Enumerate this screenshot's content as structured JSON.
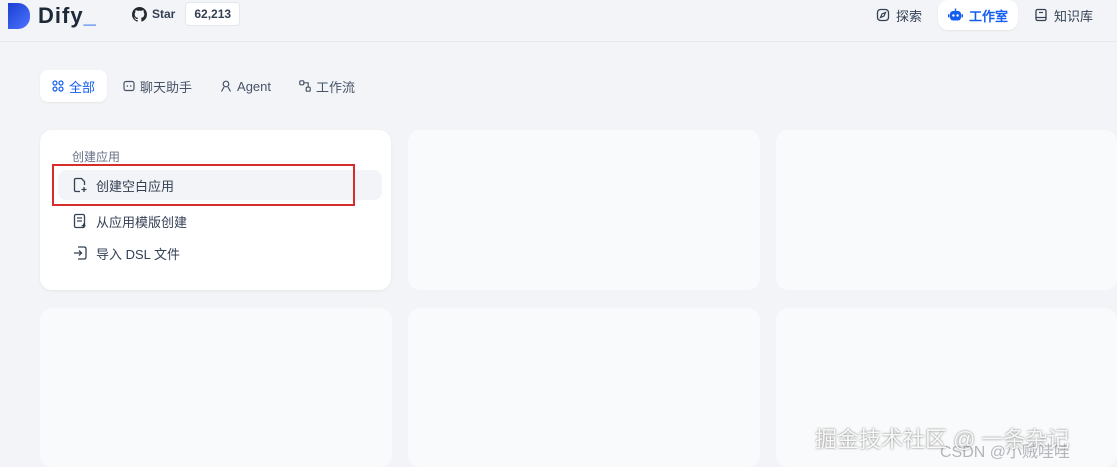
{
  "brand": {
    "name": "Dify",
    "cursor": "_"
  },
  "github": {
    "star_label": "Star",
    "star_count": "62,213"
  },
  "nav": {
    "items": [
      {
        "label": "探索",
        "icon": "compass-icon"
      },
      {
        "label": "工作室",
        "icon": "robot-icon"
      },
      {
        "label": "知识库",
        "icon": "book-icon"
      }
    ]
  },
  "tabs": [
    {
      "label": "全部",
      "icon": "grid-icon"
    },
    {
      "label": "聊天助手",
      "icon": "chat-icon"
    },
    {
      "label": "Agent",
      "icon": "agent-icon"
    },
    {
      "label": "工作流",
      "icon": "workflow-icon"
    }
  ],
  "create_card": {
    "title": "创建应用",
    "items": [
      {
        "label": "创建空白应用",
        "icon": "new-file-icon"
      },
      {
        "label": "从应用模版创建",
        "icon": "template-icon"
      },
      {
        "label": "导入 DSL 文件",
        "icon": "import-icon"
      }
    ]
  },
  "watermarks": {
    "csdn": "CSDN @小贼哇哇",
    "juejin": "掘金技术社区 @ 一条杂记"
  },
  "colors": {
    "accent": "#155eef",
    "page_bg": "#f2f4f7",
    "highlight": "#d62c2c"
  }
}
